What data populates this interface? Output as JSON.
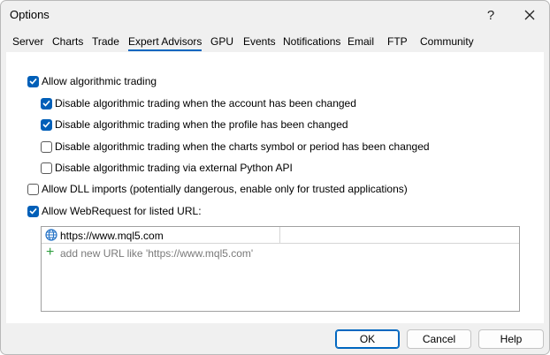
{
  "window": {
    "title": "Options",
    "help_label": "?"
  },
  "tabs": [
    {
      "label": "Server"
    },
    {
      "label": "Charts"
    },
    {
      "label": "Trade"
    },
    {
      "label": "Expert Advisors",
      "active": true
    },
    {
      "label": "GPU"
    },
    {
      "label": "Events"
    },
    {
      "label": "Notifications"
    },
    {
      "label": "Email"
    },
    {
      "label": "FTP"
    },
    {
      "label": "Community"
    }
  ],
  "options": {
    "allow_algo": {
      "label": "Allow algorithmic trading",
      "checked": true
    },
    "disable_account": {
      "label": "Disable algorithmic trading when the account has been changed",
      "checked": true
    },
    "disable_profile": {
      "label": "Disable algorithmic trading when the profile has been changed",
      "checked": true
    },
    "disable_symbol": {
      "label": "Disable algorithmic trading when the charts symbol or period has been changed",
      "checked": false
    },
    "disable_python": {
      "label": "Disable algorithmic trading via external Python API",
      "checked": false
    },
    "allow_dll": {
      "label": "Allow DLL imports (potentially dangerous, enable only for trusted applications)",
      "checked": false
    },
    "allow_webrequest": {
      "label": "Allow WebRequest for listed URL:",
      "checked": true
    }
  },
  "url_list": {
    "items": [
      {
        "url": "https://www.mql5.com",
        "icon": "globe-icon"
      }
    ],
    "add_placeholder": "add new URL like 'https://www.mql5.com'",
    "add_icon": "plus-icon"
  },
  "buttons": {
    "ok": "OK",
    "cancel": "Cancel",
    "help": "Help"
  },
  "colors": {
    "accent": "#005fb8",
    "add_icon": "#2e9e3e",
    "placeholder": "#7a7a7a"
  }
}
